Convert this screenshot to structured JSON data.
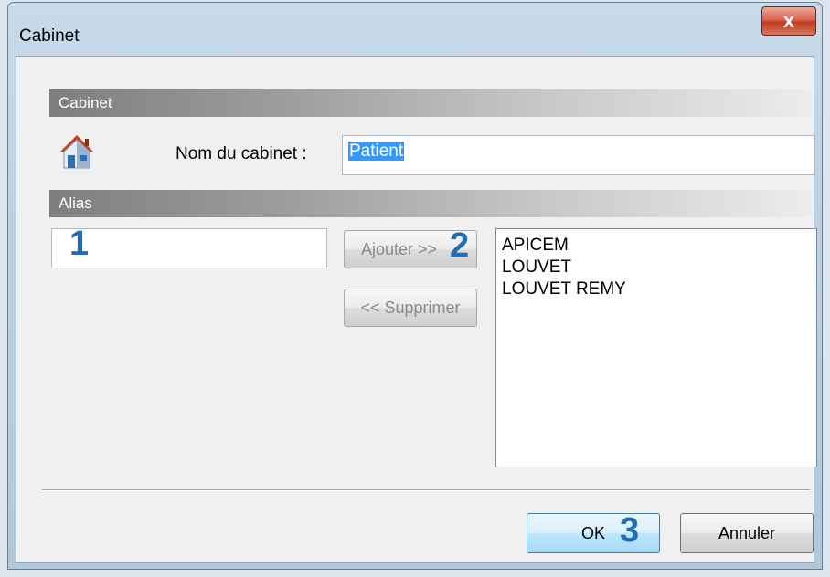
{
  "window": {
    "title": "Cabinet",
    "close_glyph": "x"
  },
  "sections": {
    "cabinet_header": "Cabinet",
    "alias_header": "Alias"
  },
  "form": {
    "nom_label": "Nom du cabinet :",
    "nom_value": "Patient",
    "alias_input_value": ""
  },
  "buttons": {
    "ajouter": "Ajouter >>",
    "supprimer": "<< Supprimer",
    "ok": "OK",
    "annuler": "Annuler"
  },
  "alias_list": [
    "APICEM",
    "LOUVET",
    "LOUVET REMY"
  ],
  "annotations": {
    "one": "1",
    "two": "2",
    "three": "3"
  },
  "icons": {
    "cabinet_icon": "house-icon"
  },
  "colors": {
    "annotation": "#1f6db7",
    "selection": "#3399ff"
  }
}
